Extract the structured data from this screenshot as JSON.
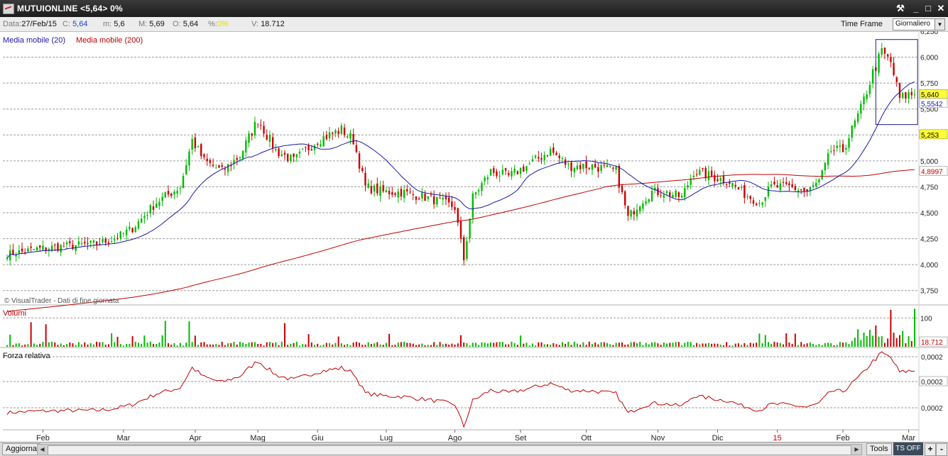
{
  "window": {
    "title": "MUTUIONLINE <5,64> 0%",
    "buttons": [
      "⚒",
      "_",
      "□",
      "✕"
    ]
  },
  "infobar": {
    "data_label": "Data:",
    "data_value": "27/Feb/15",
    "c_label": "C:",
    "c_value": "5,64",
    "m_label": "m:",
    "m_value": "5,6",
    "M_label": "M:",
    "M_value": "5,69",
    "o_label": "O:",
    "o_value": "5,64",
    "pct_label": "%:",
    "pct_value": "0%",
    "v_label": "V:",
    "v_value": "18.712",
    "timeframe_label": "Time Frame",
    "timeframe_value": "Giornaliero"
  },
  "colors": {
    "up": "#00bb00",
    "down": "#cc0000",
    "ma20": "#1a1aa8",
    "ma200": "#c00000",
    "rs_line": "#c00000",
    "grid": "#9a9a9a",
    "highlight": "#1a1a90",
    "label_yellow": "#ffff33"
  },
  "chart_data": [
    {
      "type": "candlestick",
      "pane": "price",
      "legend": [
        {
          "name": "Media mobile (20)",
          "color": "#1a1aa8"
        },
        {
          "name": "Media mobile (200)",
          "color": "#c00000"
        }
      ],
      "watermark": "© VisualTrader - Dati di fine giornata",
      "ylim": [
        3.625,
        6.25
      ],
      "y_ticks": [
        "3,750",
        "4,000",
        "4,250",
        "4,500",
        "4,750",
        "5,000",
        "5,250",
        "5,500",
        "5,750",
        "6,000"
      ],
      "y_tick_values": [
        3.75,
        4.0,
        4.25,
        4.5,
        4.75,
        5.0,
        5.25,
        5.5,
        5.75,
        6.0
      ],
      "price_labels": [
        {
          "text": "5,640",
          "value": 5.64,
          "style": "yellow"
        },
        {
          "text": "5,5542",
          "value": 5.5542,
          "style": "blue"
        },
        {
          "text": "5,253",
          "value": 5.253,
          "style": "yellow"
        },
        {
          "text": "4,8997",
          "value": 4.8997,
          "style": "red"
        }
      ],
      "x_labels": [
        "Feb",
        "Mar",
        "Apr",
        "Mag",
        "Giu",
        "Lug",
        "Ago",
        "Set",
        "Ott",
        "Nov",
        "Dic",
        "15",
        "Feb",
        "Mar"
      ],
      "x_label_sessions": [
        12,
        39,
        63,
        84,
        104,
        127,
        150,
        172,
        194,
        218,
        238,
        258,
        280,
        302
      ],
      "total_sessions": 305,
      "anchors": [
        [
          0,
          4.1
        ],
        [
          10,
          4.15
        ],
        [
          20,
          4.18
        ],
        [
          30,
          4.2
        ],
        [
          36,
          4.25
        ],
        [
          42,
          4.35
        ],
        [
          50,
          4.6
        ],
        [
          58,
          4.75
        ],
        [
          62,
          5.2
        ],
        [
          66,
          5.0
        ],
        [
          72,
          4.9
        ],
        [
          78,
          5.05
        ],
        [
          84,
          5.4
        ],
        [
          90,
          5.1
        ],
        [
          96,
          5.0
        ],
        [
          104,
          5.2
        ],
        [
          112,
          5.3
        ],
        [
          116,
          5.2
        ],
        [
          120,
          4.75
        ],
        [
          126,
          4.7
        ],
        [
          132,
          4.7
        ],
        [
          140,
          4.65
        ],
        [
          146,
          4.6
        ],
        [
          150,
          4.55
        ],
        [
          153,
          4.05
        ],
        [
          156,
          4.65
        ],
        [
          162,
          4.9
        ],
        [
          168,
          4.85
        ],
        [
          174,
          4.95
        ],
        [
          182,
          5.1
        ],
        [
          188,
          4.95
        ],
        [
          196,
          4.95
        ],
        [
          204,
          4.9
        ],
        [
          208,
          4.45
        ],
        [
          212,
          4.6
        ],
        [
          216,
          4.7
        ],
        [
          220,
          4.7
        ],
        [
          226,
          4.65
        ],
        [
          230,
          4.9
        ],
        [
          236,
          4.85
        ],
        [
          242,
          4.8
        ],
        [
          246,
          4.7
        ],
        [
          252,
          4.6
        ],
        [
          256,
          4.75
        ],
        [
          262,
          4.75
        ],
        [
          268,
          4.7
        ],
        [
          272,
          4.8
        ],
        [
          276,
          5.1
        ],
        [
          280,
          5.1
        ],
        [
          286,
          5.5
        ],
        [
          290,
          5.85
        ],
        [
          293,
          6.05
        ],
        [
          296,
          5.95
        ],
        [
          299,
          5.6
        ],
        [
          302,
          5.64
        ]
      ],
      "highlight_box": {
        "x_sessions": [
          291,
          305
        ],
        "ylim": [
          5.35,
          6.17
        ]
      },
      "series": [
        {
          "name": "Media mobile (20)",
          "period": 20
        },
        {
          "name": "Media mobile (200)",
          "period": 200
        }
      ]
    },
    {
      "type": "bar",
      "pane": "volume",
      "title": "Volumi",
      "y_ticks": [
        "100"
      ],
      "y_tick_values": [
        100
      ],
      "ylim": [
        0,
        140
      ],
      "last_value_label": "18.712",
      "peaks": [
        {
          "session": 8,
          "value": 85
        },
        {
          "session": 13,
          "value": 78
        },
        {
          "session": 53,
          "value": 90
        },
        {
          "session": 61,
          "value": 88
        },
        {
          "session": 93,
          "value": 82
        },
        {
          "session": 296,
          "value": 128
        },
        {
          "session": 304,
          "value": 132
        }
      ]
    },
    {
      "type": "line",
      "pane": "relative_strength",
      "title": "Forza relativa",
      "y_ticks": [
        "0,0002",
        "0,0002",
        "0,0002"
      ],
      "y_tick_values": [
        0.00026,
        0.00023,
        0.0002
      ]
    }
  ],
  "bottombar": {
    "refresh_button": "Aggiorna",
    "tools_button": "Tools",
    "ts_button": "TS OFF",
    "plus_button": "+",
    "minus_button": "-"
  }
}
